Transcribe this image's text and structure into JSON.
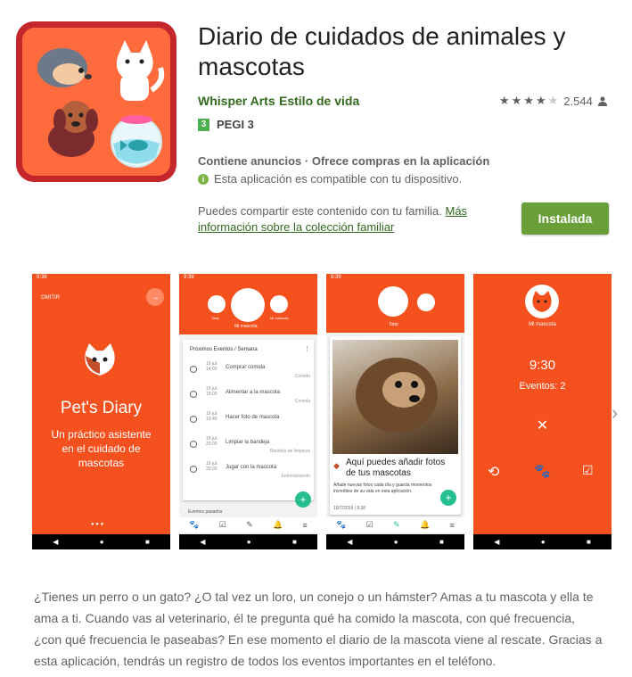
{
  "app": {
    "title": "Diario de cuidados de animales y mascotas",
    "developer": "Whisper Arts",
    "category": "Estilo de vida",
    "rating_stars": 4,
    "rating_count": "2.544",
    "pegi_badge": "3",
    "pegi": "PEGI 3",
    "ads_line": "Contiene anuncios · Ofrece compras en la aplicación",
    "compat": "Esta aplicación es compatible con tu dispositivo.",
    "family_text": "Puedes compartir este contenido con tu familia.",
    "family_link": "Más información sobre la colección familiar",
    "install_label": "Instalada",
    "description": "¿Tienes un perro o un gato? ¿O tal vez un loro, un conejo o un hámster? Amas a tu mascota y ella te ama a ti. Cuando vas al veterinario, él te pregunta qué ha comido la mascota, con qué frecuencia, ¿con qué frecuencia le paseabas? En ese momento el diario de la mascota viene al rescate. Gracias a esta aplicación, tendrás un registro de todos los eventos importantes en el teléfono."
  },
  "colors": {
    "accent": "#33691e",
    "install": "#689f38",
    "app_orange": "#f4511e"
  },
  "shot1": {
    "time": "9:38",
    "skip": "OMITIR",
    "app_name": "Pet's Diary",
    "tagline": "Un práctico asistente en el cuidado de mascotas"
  },
  "shot2": {
    "time": "9:38",
    "tab_left": "Total",
    "tab_center": "Mi mascota",
    "tab_right": "Mi mascota",
    "card_title": "Próximos Eventos / Semana",
    "events": [
      {
        "date": "19 jul.",
        "time": "14:00",
        "name": "Comprar comida",
        "tag": "Comida"
      },
      {
        "date": "19 jul.",
        "time": "19:00",
        "name": "Alimentar a la mascota",
        "tag": "Comida"
      },
      {
        "date": "19 jul.",
        "time": "19:40",
        "name": "Hacer foto de mascota",
        "tag": ""
      },
      {
        "date": "19 jul.",
        "time": "20:00",
        "name": "Limpiar la bandeja",
        "tag": "Bandeja de limpieza"
      },
      {
        "date": "19 jul.",
        "time": "20:30",
        "name": "Jugar con la mascota",
        "tag": "Entrenamiento"
      }
    ],
    "more": "Eventos pasados"
  },
  "shot3": {
    "time": "9:39",
    "tab_label": "Total",
    "post_title": "Aquí puedes añadir fotos de tus mascotas",
    "post_text": "Añade nuevas fotos cada día y guarda momentos increíbles de su vida en esta aplicación.",
    "post_date": "19/7/2019 | 9:38"
  },
  "shot4": {
    "label": "Mi mascota",
    "time": "9:30",
    "events": "Eventos: 2"
  },
  "icons": {
    "next": "chevron-right-icon",
    "person": "person-icon",
    "info": "info-icon"
  }
}
